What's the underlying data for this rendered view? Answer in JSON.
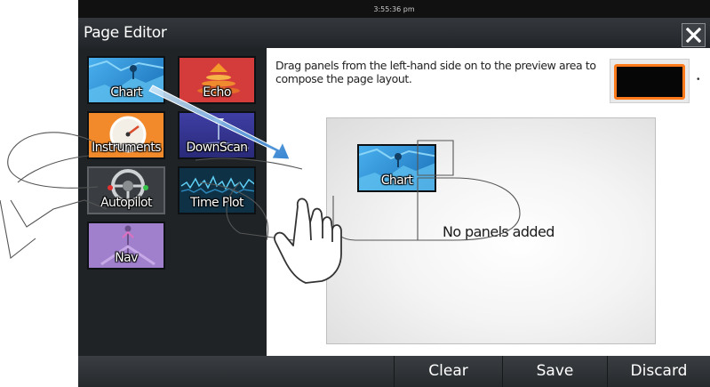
{
  "status_bar": {
    "time": "3:55:36 pm"
  },
  "title_bar": {
    "title": "Page Editor",
    "close_icon": "close-icon"
  },
  "panels": [
    {
      "id": "chart",
      "label": "Chart",
      "color": "#2a8fd6"
    },
    {
      "id": "echo",
      "label": "Echo",
      "color": "#d64040"
    },
    {
      "id": "instruments",
      "label": "Instruments",
      "color": "#f0882a"
    },
    {
      "id": "downscan",
      "label": "DownScan",
      "color": "#4a4ab0"
    },
    {
      "id": "autopilot",
      "label": "Autopilot",
      "color": "#3b3f43"
    },
    {
      "id": "timeplot",
      "label": "Time Plot",
      "color": "#123a52"
    },
    {
      "id": "nav",
      "label": "Nav",
      "color": "#9a78c8"
    }
  ],
  "editor": {
    "instructions": "Drag panels from the left-hand side on to the preview area to compose the page layout.",
    "layout_dropdown_icon": "chevron-down-icon",
    "preview_empty_message": "No panels added",
    "dragging_panel_label": "Chart"
  },
  "bottom_bar": {
    "clear": "Clear",
    "save": "Save",
    "discard": "Discard"
  }
}
